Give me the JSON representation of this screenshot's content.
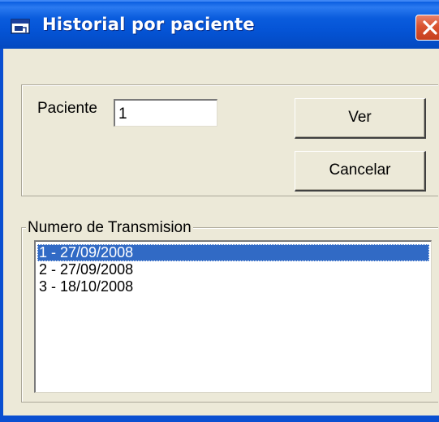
{
  "window": {
    "title": "Historial por paciente",
    "title_icon": "window-app-icon",
    "close_icon": "close-icon"
  },
  "form": {
    "patient_label": "Paciente",
    "patient_value": "1",
    "view_button": "Ver",
    "cancel_button": "Cancelar"
  },
  "transmissions": {
    "group_label": "Numero de Transmision",
    "items": [
      {
        "label": "1 - 27/09/2008",
        "selected": true
      },
      {
        "label": "2 - 27/09/2008",
        "selected": false
      },
      {
        "label": "3 - 18/10/2008",
        "selected": false
      }
    ]
  },
  "colors": {
    "titlebar": "#0554d6",
    "selection": "#316ac5",
    "dialog_bg": "#ece9d8",
    "close_button": "#d9532f"
  }
}
